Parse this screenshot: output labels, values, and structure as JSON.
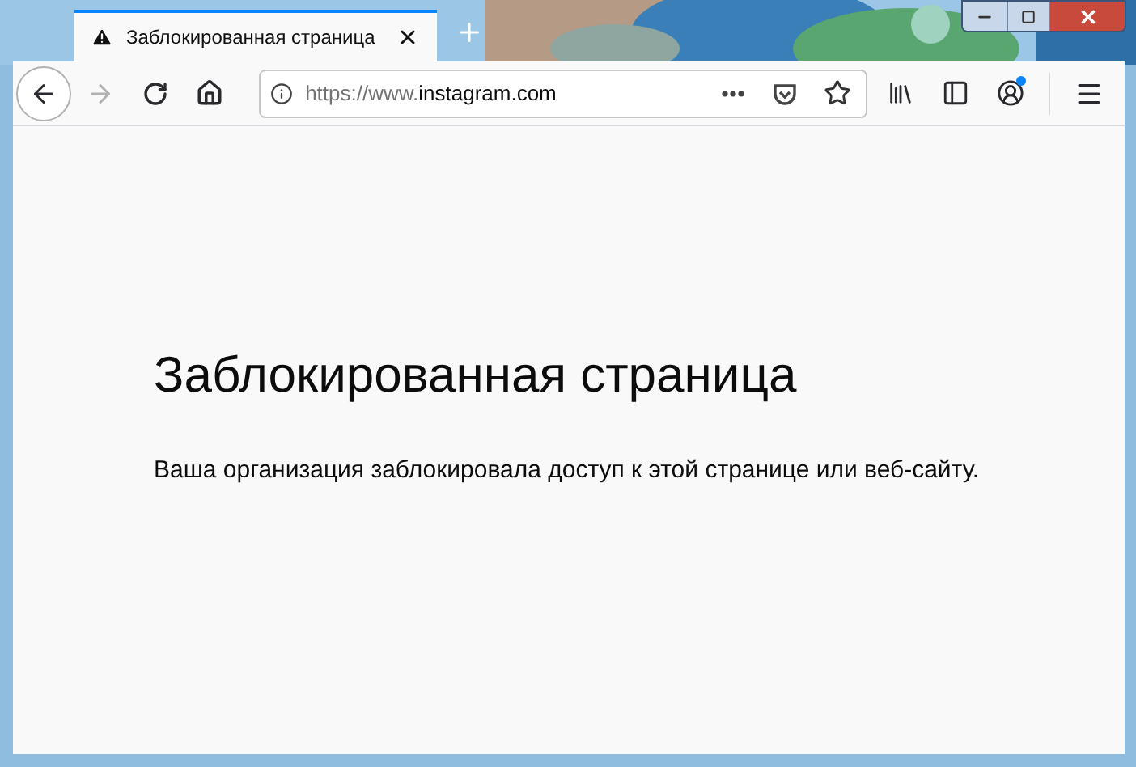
{
  "tab": {
    "title": "Заблокированная страница",
    "selected": true
  },
  "address_bar": {
    "url_prefix": "https://www.",
    "url_domain": "instagram.com"
  },
  "account": {
    "notification": true
  },
  "page": {
    "heading": "Заблокированная страница",
    "message": "Ваша организация заблокировала доступ к этой странице или веб-сайту."
  }
}
